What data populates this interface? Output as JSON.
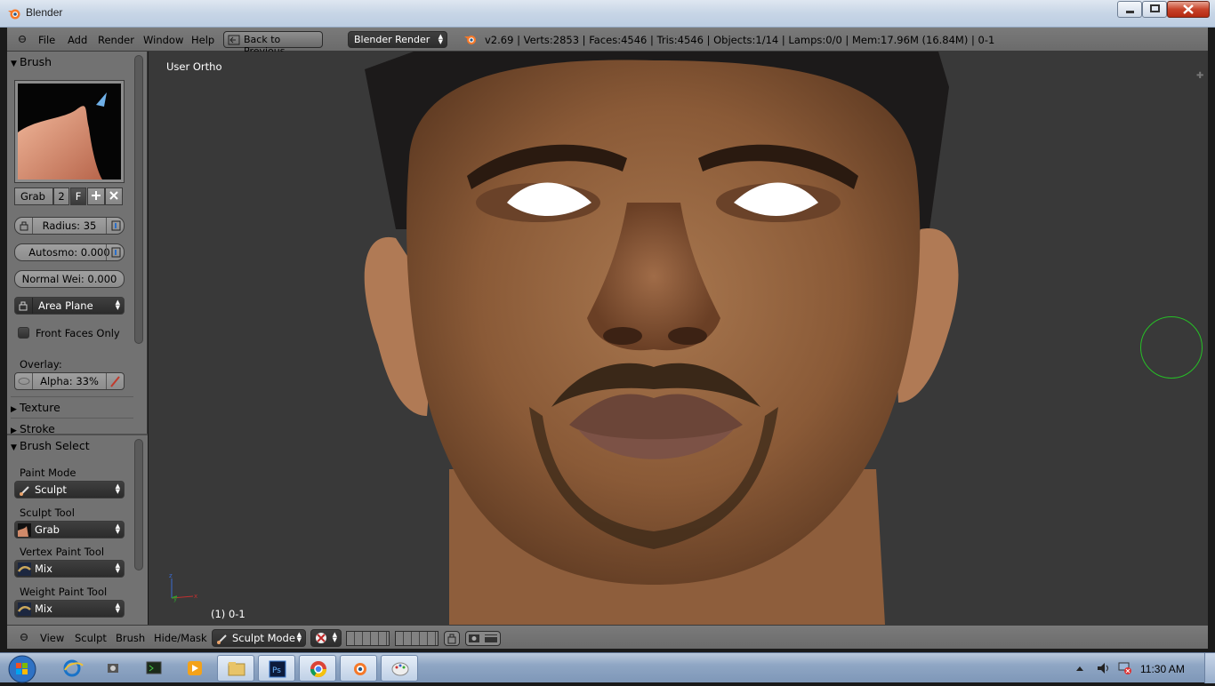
{
  "window": {
    "title": "Blender"
  },
  "info_header": {
    "menus": [
      "File",
      "Add",
      "Render",
      "Window",
      "Help"
    ],
    "back_button": "Back to Previous",
    "render_engine": "Blender Render",
    "stats": "v2.69 | Verts:2853 | Faces:4546 | Tris:4546 | Objects:1/14 | Lamps:0/0 | Mem:17.96M (16.84M) | 0-1"
  },
  "tool_shelf": {
    "brush_panel": "Brush",
    "brush_name": "Grab",
    "brush_users": "2",
    "brush_fake": "F",
    "radius": "Radius: 35",
    "autosmooth": "Autosmo: 0.000",
    "normal_weight": "Normal Wei: 0.000",
    "plane": "Area Plane",
    "front_faces_only": "Front Faces Only",
    "overlay_label": "Overlay:",
    "alpha": "Alpha: 33%",
    "texture_panel": "Texture",
    "stroke_panel": "Stroke",
    "brush_select_panel": "Brush Select",
    "paint_mode_label": "Paint Mode",
    "paint_mode": "Sculpt",
    "sculpt_tool_label": "Sculpt Tool",
    "sculpt_tool": "Grab",
    "vertex_paint_tool_label": "Vertex Paint Tool",
    "vertex_paint_tool": "Mix",
    "weight_paint_tool_label": "Weight Paint Tool",
    "weight_paint_tool": "Mix"
  },
  "viewport": {
    "view_name": "User Ortho",
    "frame_label": "(1) 0-1"
  },
  "bottom_header": {
    "menus": [
      "View",
      "Sculpt",
      "Brush",
      "Hide/Mask"
    ],
    "mode": "Sculpt Mode"
  },
  "taskbar": {
    "icons": [
      "start-orb-icon",
      "ie-icon",
      "devices-icon",
      "terminal-icon",
      "media-player-icon",
      "explorer-icon",
      "photoshop-icon",
      "chrome-icon",
      "blender-icon",
      "paint-icon"
    ],
    "clock": "11:30 AM"
  },
  "colors": {
    "blender_panel": "#727272",
    "viewport_bg": "#393939",
    "brush_cursor": "#26c026"
  }
}
